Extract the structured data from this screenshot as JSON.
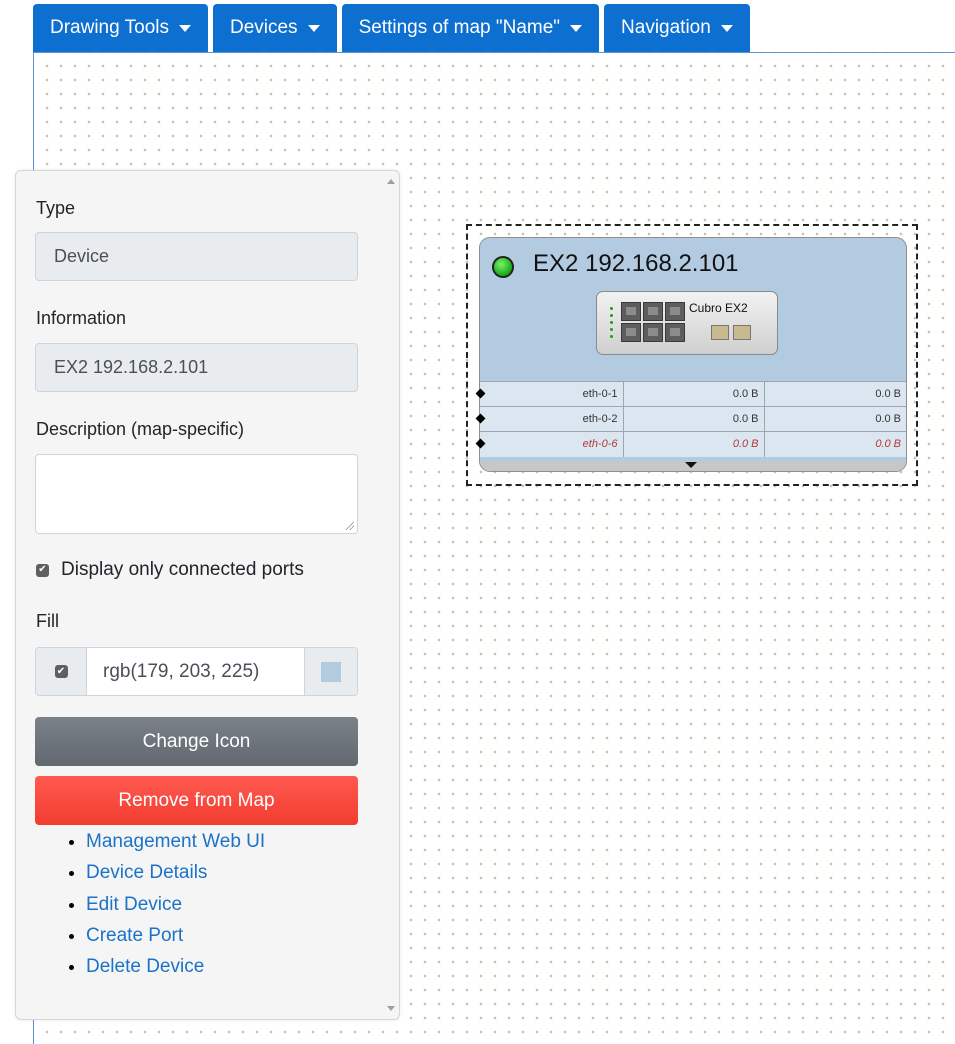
{
  "nav": {
    "drawing_tools": "Drawing Tools",
    "devices": "Devices",
    "settings": "Settings of map \"Name\"",
    "navigation": "Navigation"
  },
  "panel": {
    "type_label": "Type",
    "type_value": "Device",
    "information_label": "Information",
    "information_value": "EX2 192.168.2.101",
    "description_label": "Description (map-specific)",
    "description_value": "",
    "connected_ports_label": "Display only connected ports",
    "connected_ports_checked": true,
    "fill_label": "Fill",
    "fill_enabled": true,
    "fill_value": "rgb(179, 203, 225)",
    "fill_color": "#b3cbe1",
    "change_icon_label": "Change Icon",
    "remove_label": "Remove from Map",
    "links": [
      "Management Web UI",
      "Device Details",
      "Edit Device",
      "Create Port",
      "Delete Device"
    ]
  },
  "node": {
    "title": "EX2 192.168.2.101",
    "status": "online",
    "status_color": "#22b521",
    "device_model": "Cubro EX2",
    "ports": [
      {
        "name": "eth-0-1",
        "in": "0.0 B",
        "out": "0.0 B",
        "active": true
      },
      {
        "name": "eth-0-2",
        "in": "0.0 B",
        "out": "0.0 B",
        "active": true
      },
      {
        "name": "eth-0-6",
        "in": "0.0 B",
        "out": "0.0 B",
        "active": false
      }
    ]
  },
  "colors": {
    "nav_bg": "#0d6fd0",
    "remove_button": "#f33c30",
    "change_icon_button": "#62686f",
    "link": "#1a73c8"
  }
}
